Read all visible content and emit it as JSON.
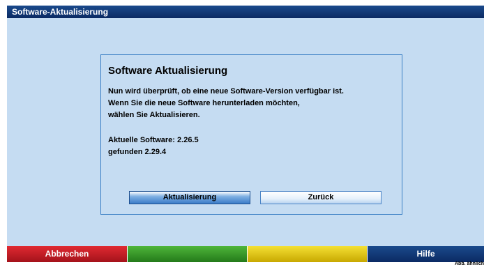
{
  "window": {
    "title": "Software-Aktualisierung"
  },
  "dialog": {
    "title": "Software Aktualisierung",
    "lines": [
      "Nun wird überprüft, ob eine neue Software-Version verfügbar ist.",
      "Wenn Sie die neue Software herunterladen möchten,",
      "wählen Sie Aktualisieren."
    ],
    "current_software": "Aktuelle Software: 2.26.5",
    "found_software": "gefunden 2.29.4",
    "buttons": {
      "update": "Aktualisierung",
      "back": "Zurück"
    }
  },
  "footer": {
    "red": "Abbrechen",
    "green": "",
    "yellow": "",
    "blue": "Hilfe"
  },
  "note": "Abb. ähnlich",
  "colors": {
    "titlebar": "#0b2a63",
    "background": "#c5dcf2",
    "red": "#c01a22",
    "green": "#3a9a2a",
    "yellow": "#e0c81a",
    "blue": "#0b2a63"
  }
}
